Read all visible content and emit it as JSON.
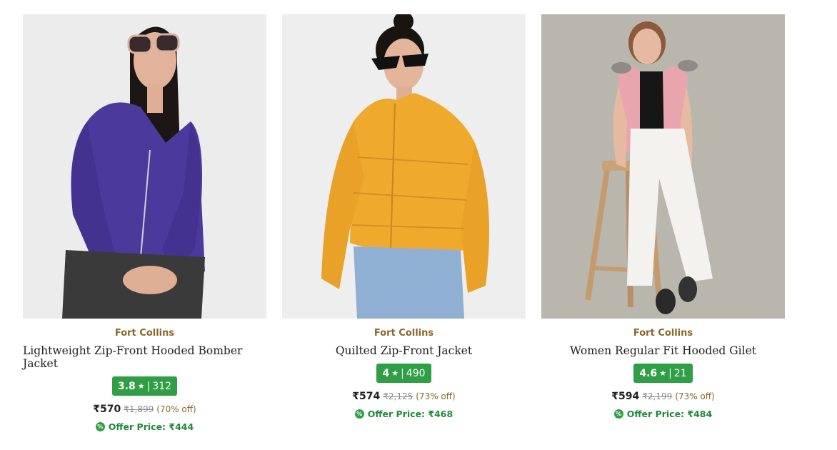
{
  "products": [
    {
      "brand": "Fort Collins",
      "title": "Lightweight Zip-Front Hooded Bomber Jacket",
      "rating": "3.8",
      "reviews": "312",
      "price": "₹570",
      "mrp": "₹1,899",
      "discount": "(70% off)",
      "offer": "Offer Price: ₹444",
      "image_colors": {
        "bg": "#ececec",
        "garment": "#4b3a9c",
        "bottom": "#3a3a3a"
      }
    },
    {
      "brand": "Fort Collins",
      "title": "Quilted Zip-Front Jacket",
      "rating": "4",
      "reviews": "490",
      "price": "₹574",
      "mrp": "₹2,125",
      "discount": "(73% off)",
      "offer": "Offer Price: ₹468",
      "image_colors": {
        "bg": "#eeeeee",
        "garment": "#efaa2e",
        "bottom": "#8fb0d2"
      }
    },
    {
      "brand": "Fort Collins",
      "title": "Women Regular Fit Hooded Gilet",
      "rating": "4.6",
      "reviews": "21",
      "price": "₹594",
      "mrp": "₹2,199",
      "discount": "(73% off)",
      "offer": "Offer Price: ₹484",
      "image_colors": {
        "bg": "#b9b6ae",
        "garment": "#e8a5ad",
        "bottom": "#f4f2ee"
      }
    }
  ],
  "rating_star": "★",
  "rating_separator": "|",
  "offer_icon_glyph": "%",
  "icons": {
    "rating": "star-icon",
    "offer": "percent-badge-icon"
  }
}
